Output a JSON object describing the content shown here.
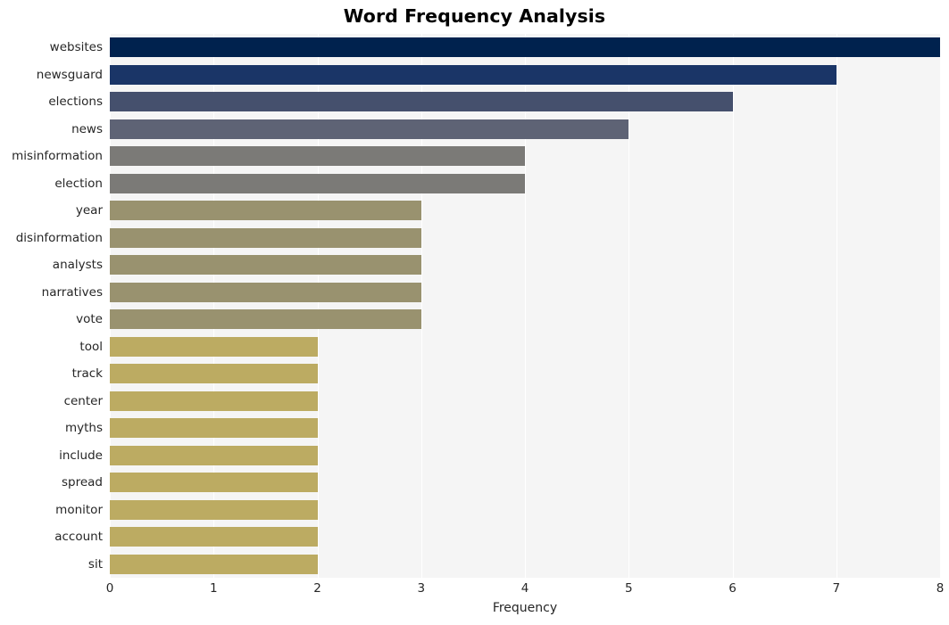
{
  "chart_data": {
    "type": "bar",
    "orientation": "horizontal",
    "title": "Word Frequency Analysis",
    "xlabel": "Frequency",
    "ylabel": "",
    "xlim": [
      0,
      8
    ],
    "xticks": [
      0,
      1,
      2,
      3,
      4,
      5,
      6,
      7,
      8
    ],
    "xtick_labels": [
      "0",
      "1",
      "2",
      "3",
      "4",
      "5",
      "6",
      "7",
      "8"
    ],
    "grid": "vertical-white-on-gray",
    "legend": "none",
    "colormap": "cividis",
    "categories": [
      "websites",
      "newsguard",
      "elections",
      "news",
      "misinformation",
      "election",
      "year",
      "disinformation",
      "analysts",
      "narratives",
      "vote",
      "tool",
      "track",
      "center",
      "myths",
      "include",
      "spread",
      "monitor",
      "account",
      "sit"
    ],
    "values": [
      8,
      7,
      6,
      5,
      4,
      4,
      3,
      3,
      3,
      3,
      3,
      2,
      2,
      2,
      2,
      2,
      2,
      2,
      2,
      2
    ],
    "bar_colors": [
      "#00224e",
      "#1a3567",
      "#45506d",
      "#5e6375",
      "#7b7a77",
      "#7b7a77",
      "#99926f",
      "#99926f",
      "#99926f",
      "#99926f",
      "#99926f",
      "#bcab62",
      "#bcab62",
      "#bcab62",
      "#bcab62",
      "#bcab62",
      "#bcab62",
      "#bcab62",
      "#bcab62",
      "#bcab62"
    ],
    "bars": [
      {
        "label": "websites",
        "value": 8,
        "color": "#00224e"
      },
      {
        "label": "newsguard",
        "value": 7,
        "color": "#1a3567"
      },
      {
        "label": "elections",
        "value": 6,
        "color": "#45506d"
      },
      {
        "label": "news",
        "value": 5,
        "color": "#5e6375"
      },
      {
        "label": "misinformation",
        "value": 4,
        "color": "#7b7a77"
      },
      {
        "label": "election",
        "value": 4,
        "color": "#7b7a77"
      },
      {
        "label": "year",
        "value": 3,
        "color": "#99926f"
      },
      {
        "label": "disinformation",
        "value": 3,
        "color": "#99926f"
      },
      {
        "label": "analysts",
        "value": 3,
        "color": "#99926f"
      },
      {
        "label": "narratives",
        "value": 3,
        "color": "#99926f"
      },
      {
        "label": "vote",
        "value": 3,
        "color": "#99926f"
      },
      {
        "label": "tool",
        "value": 2,
        "color": "#bcab62"
      },
      {
        "label": "track",
        "value": 2,
        "color": "#bcab62"
      },
      {
        "label": "center",
        "value": 2,
        "color": "#bcab62"
      },
      {
        "label": "myths",
        "value": 2,
        "color": "#bcab62"
      },
      {
        "label": "include",
        "value": 2,
        "color": "#bcab62"
      },
      {
        "label": "spread",
        "value": 2,
        "color": "#bcab62"
      },
      {
        "label": "monitor",
        "value": 2,
        "color": "#bcab62"
      },
      {
        "label": "account",
        "value": 2,
        "color": "#bcab62"
      },
      {
        "label": "sit",
        "value": 2,
        "color": "#bcab62"
      }
    ],
    "style": {
      "figure_background": "#ffffff",
      "plot_background": "#f5f5f5",
      "grid_color": "#ffffff",
      "tick_text_color": "#262626",
      "title_color": "#000000"
    }
  }
}
